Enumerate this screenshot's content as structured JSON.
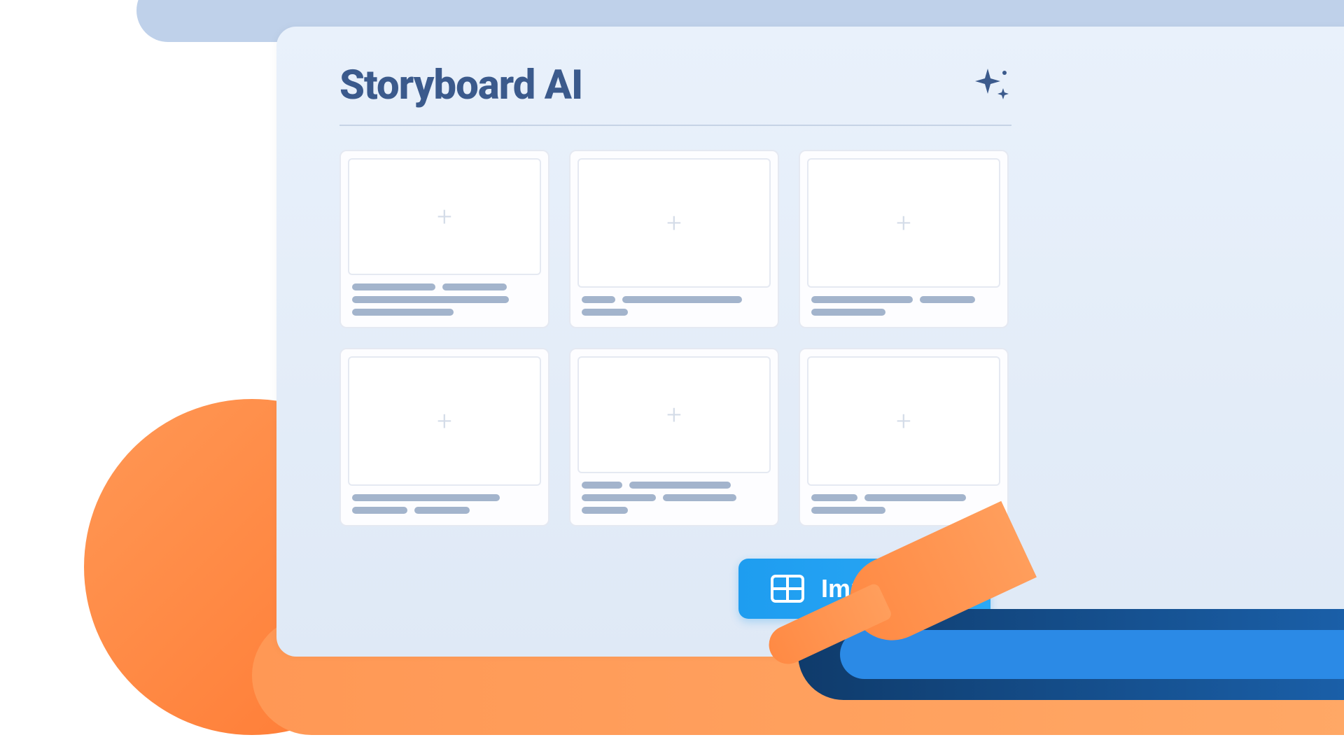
{
  "panel": {
    "title": "Storyboard AI",
    "sparkle_icon_name": "sparkle-icon"
  },
  "cards": [
    {
      "index": 0
    },
    {
      "index": 1
    },
    {
      "index": 2
    },
    {
      "index": 3
    },
    {
      "index": 4
    },
    {
      "index": 5
    }
  ],
  "actions": {
    "import_csv": {
      "label": "Import CSV",
      "icon": "table-icon"
    }
  },
  "colors": {
    "accent_blue": "#1e9df0",
    "title_navy": "#3b5a8c",
    "panel_bg": "#e9f1fb",
    "orange": "#ff8a44",
    "green": "#3fc988"
  }
}
